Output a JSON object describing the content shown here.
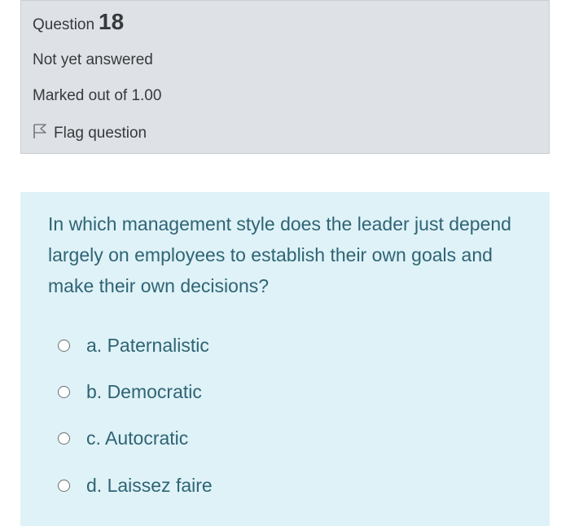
{
  "info": {
    "question_label": "Question",
    "question_number": "18",
    "state": "Not yet answered",
    "grade": "Marked out of 1.00",
    "flag_label": "Flag question"
  },
  "question": {
    "text": "In which management style does the leader just depend largely on employees to establish their own goals and make their own decisions?",
    "answers": [
      {
        "label": "a. Paternalistic"
      },
      {
        "label": "b. Democratic"
      },
      {
        "label": "c. Autocratic"
      },
      {
        "label": "d. Laissez faire"
      }
    ]
  },
  "icons": {
    "flag": "flag-outline-icon",
    "radio": "radio-unchecked-icon"
  },
  "colors": {
    "info_bg": "#dee2e6",
    "content_bg": "#def2f8",
    "question_text": "#2f6473"
  }
}
